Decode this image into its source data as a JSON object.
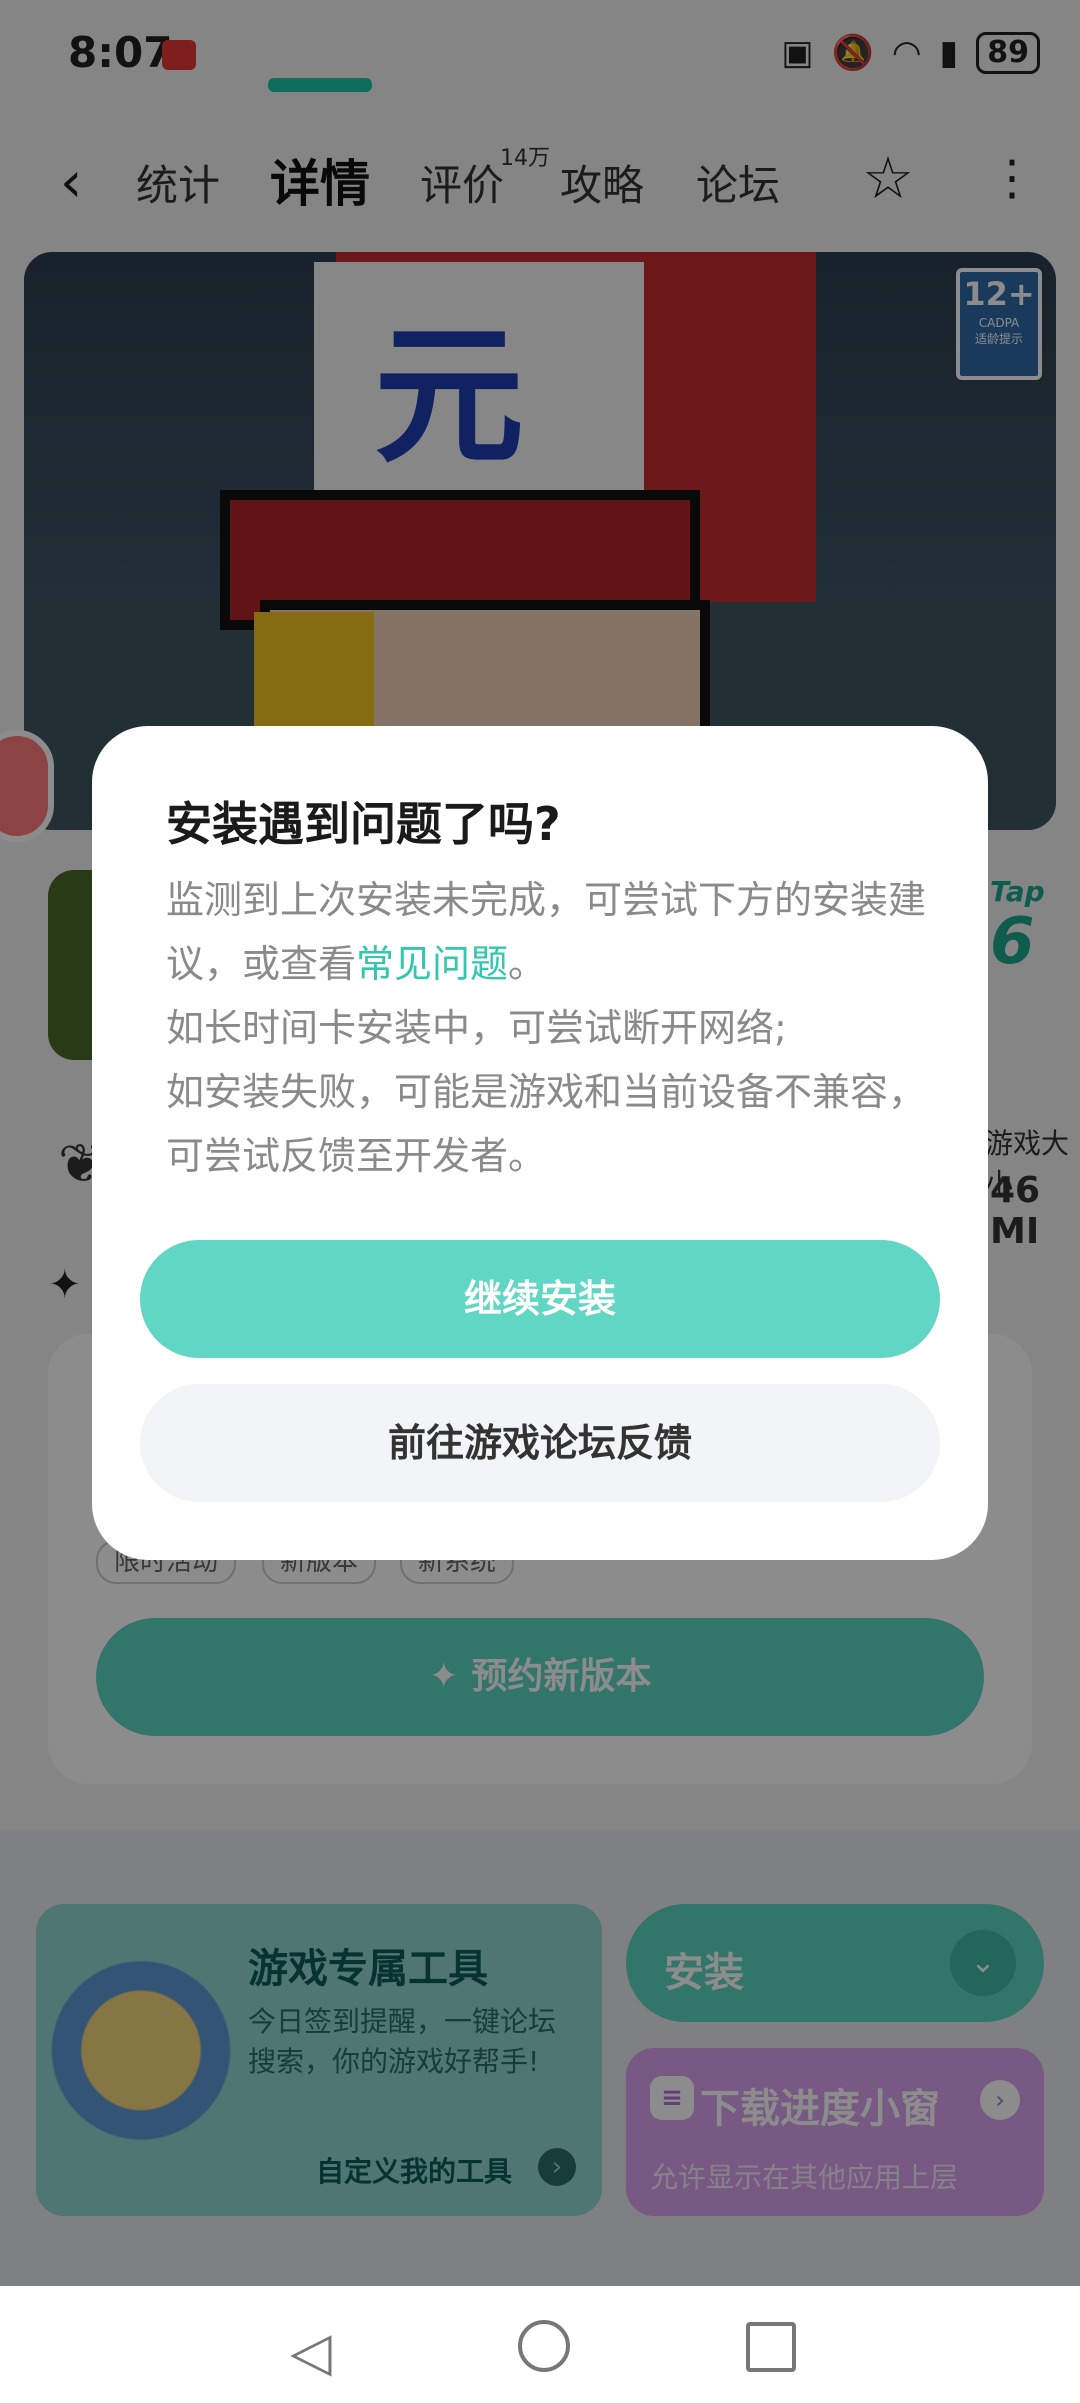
{
  "status_bar": {
    "time": "8:07",
    "battery": "89"
  },
  "nav": {
    "tabs": [
      "统计",
      "详情",
      "评价",
      "攻略",
      "论坛"
    ],
    "active_index": 1,
    "review_count": "14万"
  },
  "hero": {
    "age_rating": "12+",
    "age_org": "CADPA",
    "age_note": "适龄提示"
  },
  "game_info": {
    "tap_label": "Tap",
    "score_fragment": "6",
    "size_label_fragment": "游戏大小",
    "size_value_fragment": "46 MI"
  },
  "main_card": {
    "tags": [
      "限时活动",
      "新版本",
      "新系统"
    ],
    "reserve_button": "预约新版本"
  },
  "tool_card": {
    "title": "游戏专属工具",
    "description": "今日签到提醒，一键论坛搜索，你的游戏好帮手!",
    "link_label": "自定义我的工具"
  },
  "install_button": {
    "label": "安装"
  },
  "progress_card": {
    "title": "下载进度小窗",
    "description": "允许显示在其他应用上层"
  },
  "dialog": {
    "title": "安装遇到问题了吗?",
    "body_part1": "监测到上次安装未完成，可尝试下方的安装建议，或查看",
    "body_link": "常见问题",
    "body_part2": "。",
    "body_line2": "如长时间卡安装中，可尝试断开网络;",
    "body_line3": "如安装失败，可能是游戏和当前设备不兼容，可尝试反馈至开发者。",
    "primary_button": "继续安装",
    "secondary_button": "前往游戏论坛反馈"
  },
  "colors": {
    "accent": "#61d6c4",
    "link": "#35c6b0",
    "tool_card": "#8fd8cf",
    "progress_card": "#d9a3f0"
  },
  "icons": {
    "back": "chevron-left-icon",
    "favorite": "star-outline-icon",
    "more": "more-vertical-icon"
  }
}
